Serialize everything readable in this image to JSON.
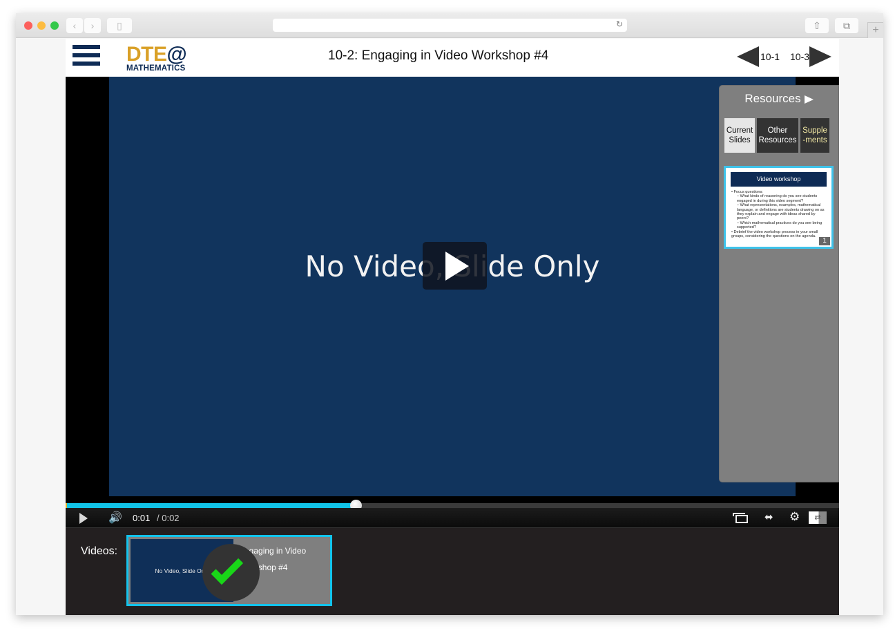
{
  "browser": {
    "back_icon": "‹",
    "forward_icon": "›",
    "sidebar_icon": "▯",
    "reload_icon": "↻",
    "share_icon": "⇧",
    "tabs_icon": "⧉",
    "newtab_icon": "+",
    "url": ""
  },
  "header": {
    "logo_main": "DTE",
    "logo_at": "@",
    "logo_sub": "MATHEMATICS",
    "title": "10-2: Engaging in Video Workshop #4",
    "prev_label": "10-1",
    "next_label": "10-3"
  },
  "player": {
    "slide_text": "No Video, Slide Only",
    "current_time": "0:01",
    "duration": "/ 0:02",
    "progress_fraction": 0.375,
    "volume_icon": "🔊",
    "expand_icon": "⬌",
    "settings_icon": "⚙",
    "swap_icon": "⇄"
  },
  "resources": {
    "title": "Resources",
    "tabs": [
      {
        "label": "Current Slides",
        "active": true
      },
      {
        "label": "Other Resources",
        "active": false
      },
      {
        "label": "Supple -ments",
        "active": false
      }
    ],
    "slide": {
      "heading": "Video workshop",
      "bullets": [
        "• Focus questions:",
        "– What kinds of reasoning do you see students engaged in during this video segment?",
        "– What representations, examples, mathematical language, or definitions are students drawing on as they explain and engage with ideas shared by peers?",
        "– Which mathematical practices do you see being supported?",
        "• Debrief the video workshop process in your small groups, considering the questions on the agenda."
      ],
      "number": "1"
    }
  },
  "videos": {
    "label": "Videos:",
    "items": [
      {
        "thumb_text": "No Video, Slide Only",
        "title": "Engaging in Video Workshop #4",
        "completed": true
      }
    ]
  },
  "colors": {
    "accent": "#12c3ec",
    "brand_gold": "#d9a027",
    "brand_navy": "#0e2b55",
    "check_green": "#19d618"
  }
}
